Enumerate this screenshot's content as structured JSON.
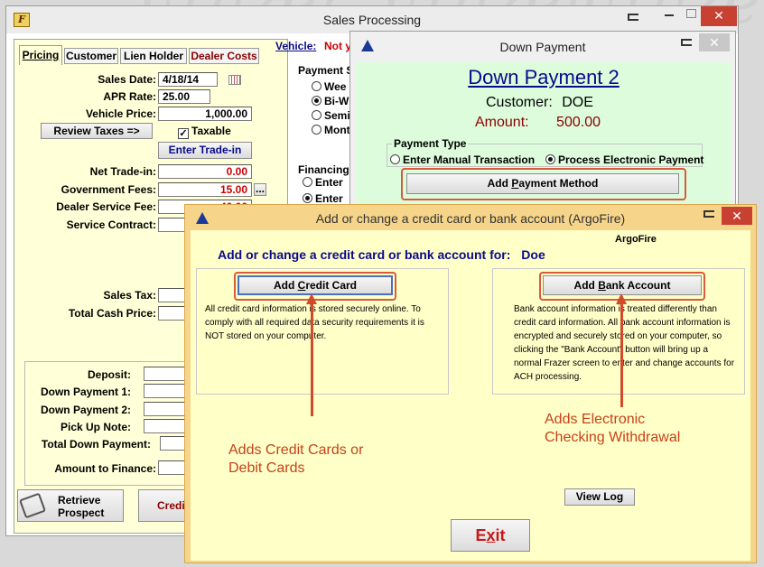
{
  "watermark": "Frazer",
  "sales": {
    "title": "Sales Processing",
    "tabs": [
      "Pricing",
      "Customer",
      "Lien Holder",
      "Dealer Costs"
    ],
    "vehicle_label": "Vehicle:",
    "vehicle_value": "Not y",
    "sales_date_label": "Sales Date:",
    "sales_date": "4/18/14",
    "apr_label": "APR Rate:",
    "apr": "25.00",
    "vehicle_price_label": "Vehicle Price:",
    "vehicle_price": "1,000.00",
    "review_taxes": "Review Taxes =>",
    "taxable_label": "Taxable",
    "enter_trade_in": "Enter Trade-in",
    "net_trade_label": "Net Trade-in:",
    "net_trade": "0.00",
    "gov_fees_label": "Government Fees:",
    "gov_fees": "15.00",
    "dealer_fee_label": "Dealer Service Fee:",
    "dealer_fee": "40.00",
    "service_contract_label": "Service Contract:",
    "sales_tax_label": "Sales Tax:",
    "total_cash_label": "Total Cash Price:",
    "deposit_label": "Deposit:",
    "down1_label": "Down Payment 1:",
    "down2_label": "Down Payment 2:",
    "pickup_label": "Pick Up Note:",
    "total_down_label": "Total Down Payment:",
    "amount_finance_label": "Amount to Finance:",
    "payment_schedule_label": "Payment S",
    "payment_options": [
      "Wee",
      "Bi-W",
      "Semi",
      "Mont"
    ],
    "financing_label": "Financing",
    "financing_options": [
      "Enter",
      "Enter"
    ],
    "retrieve_line1": "Retrieve",
    "retrieve_line2": "Prospect",
    "credit_btn": "Credi"
  },
  "down_payment": {
    "title": "Down Payment",
    "heading": "Down Payment 2",
    "customer_label": "Customer:",
    "customer": "DOE",
    "amount_label": "Amount:",
    "amount": "500.00",
    "payment_type_label": "Payment Type",
    "option_manual": "Enter Manual Transaction",
    "option_electronic": "Process Electronic Payment",
    "add_method_pre": "Add ",
    "add_method_u": "P",
    "add_method_post": "ayment Method"
  },
  "argofire": {
    "title": "Add or change a credit card or bank account (ArgoFire)",
    "heading_pre": "Add or change a credit card or bank account for:",
    "heading_name": "Doe",
    "provider": "ArgoFire",
    "credit_pre": "Add ",
    "credit_u": "C",
    "credit_post": "redit Card",
    "credit_text": "All credit card information is stored securely online. To comply with all required data security requirements it is NOT stored on your computer.",
    "bank_pre": "Add ",
    "bank_u": "B",
    "bank_post": "ank Account",
    "bank_text": "Bank account information is treated differently than credit card information.  All bank account information is encrypted and securely stored on your computer, so clicking the \"Bank Account\" button will bring up a normal Frazer screen to enter and change accounts for ACH processing.",
    "view_log": "View Log",
    "exit_pre": "E",
    "exit_u": "x",
    "exit_post": "it"
  },
  "annotations": {
    "credit_line1": "Adds Credit Cards or",
    "credit_line2": "Debit Cards",
    "bank_line1": "Adds Electronic",
    "bank_line2": "Checking Withdrawal"
  },
  "colors": {
    "heading_blue": "#0a0a8c",
    "amount_red": "#8b0000",
    "annotation": "#c8401a",
    "close_red": "#c84031",
    "yellow_bg": "#ffffc8",
    "green_bg": "#dcfcdc"
  }
}
